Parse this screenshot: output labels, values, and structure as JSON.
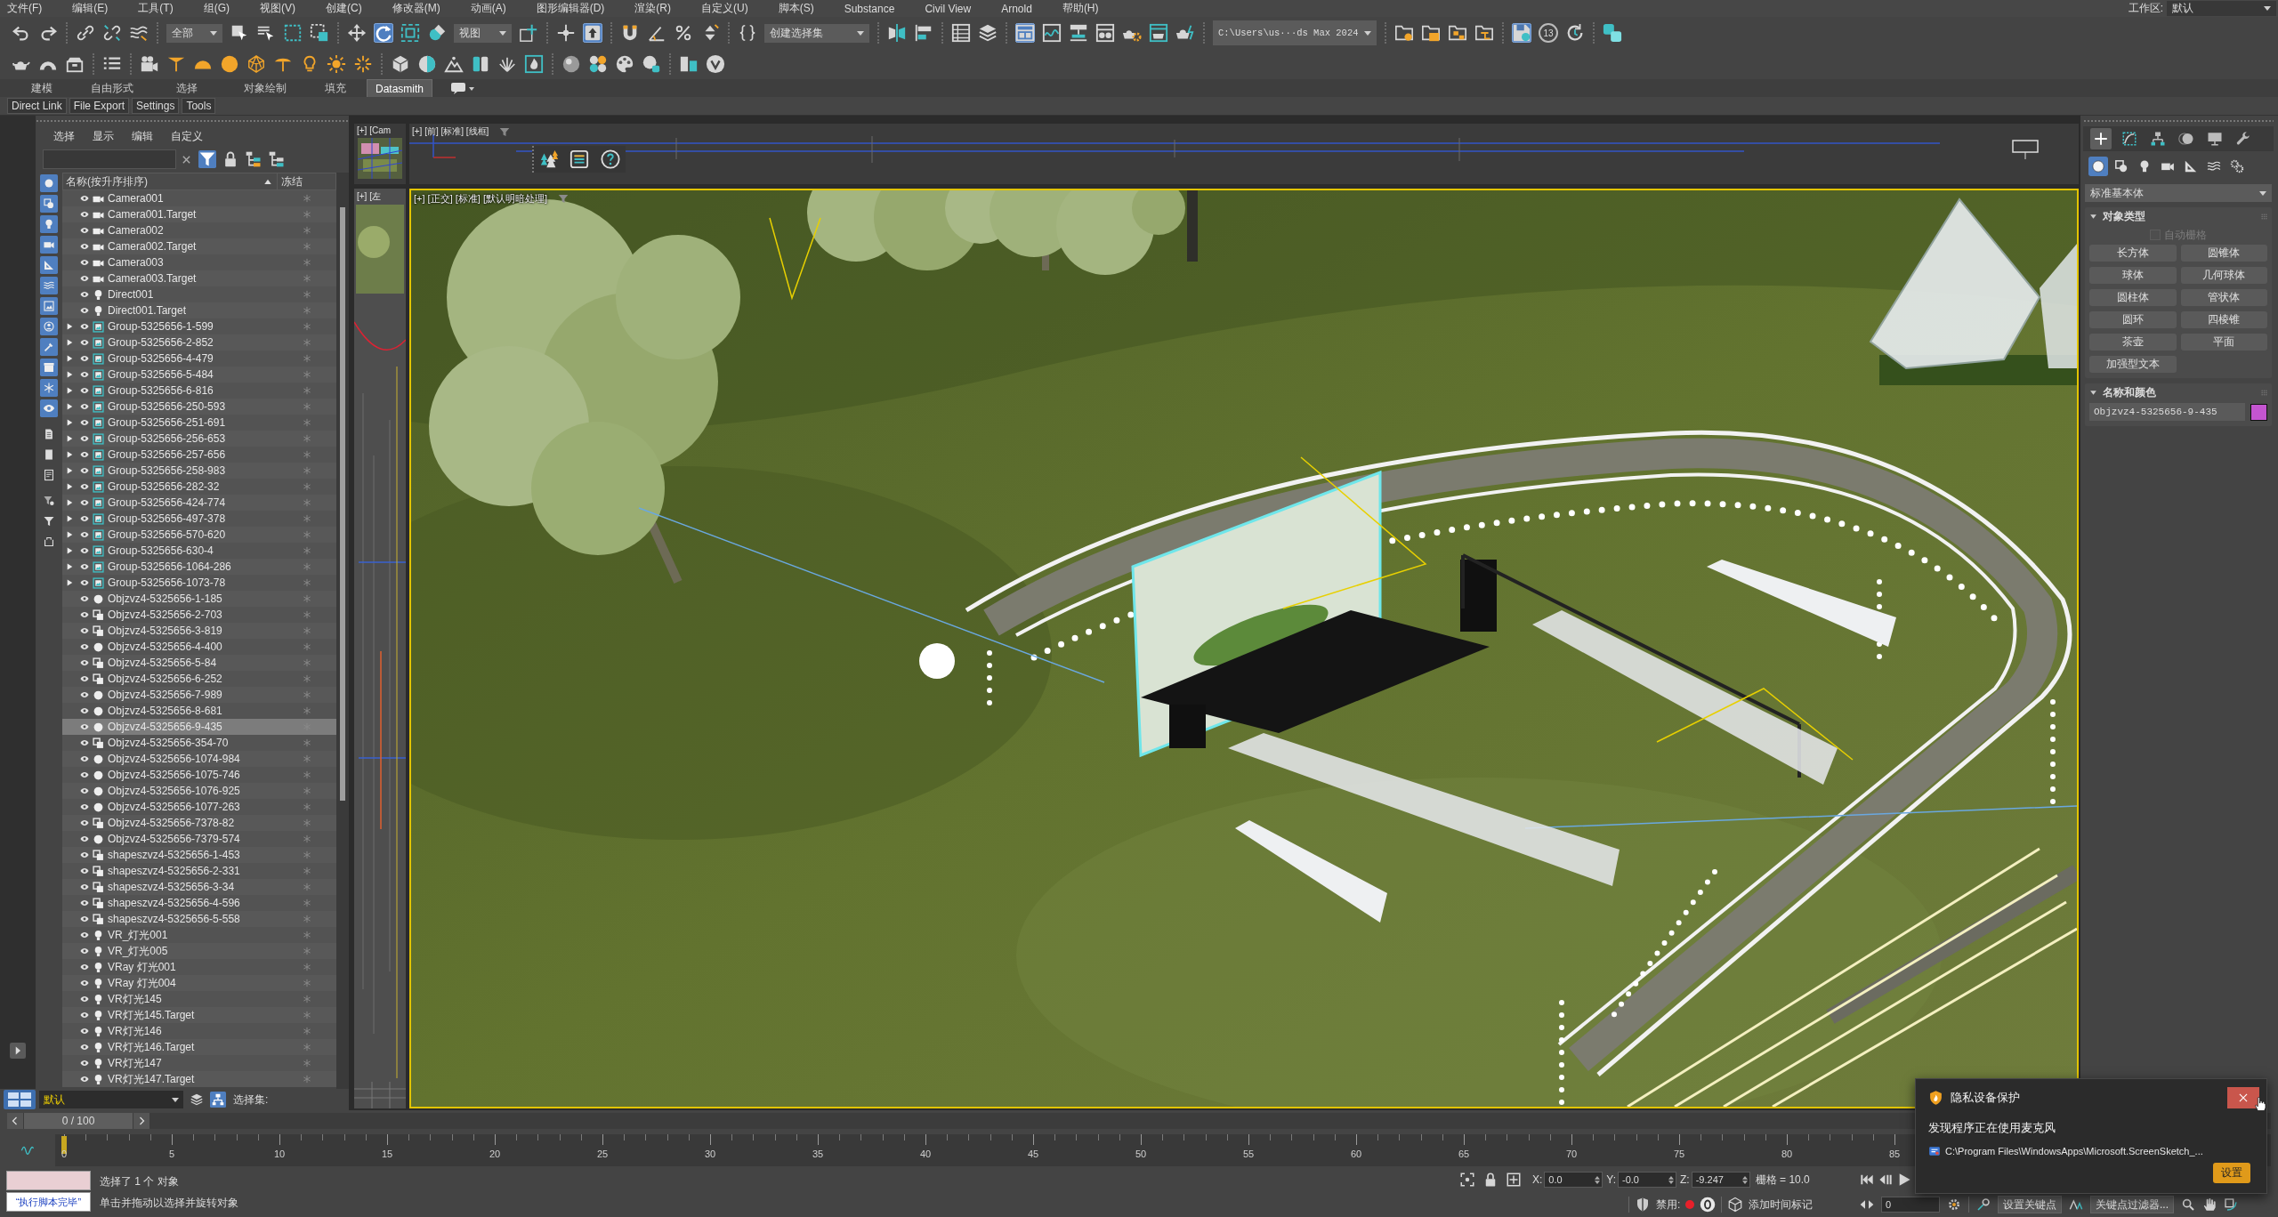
{
  "menu_bar": {
    "items": [
      "文件(F)",
      "编辑(E)",
      "工具(T)",
      "组(G)",
      "视图(V)",
      "创建(C)",
      "修改器(M)",
      "动画(A)",
      "图形编辑器(D)",
      "渲染(R)",
      "自定义(U)",
      "脚本(S)",
      "Substance",
      "Civil View",
      "Arnold",
      "帮助(H)"
    ],
    "workspace": {
      "label": "工作区:",
      "value": "默认"
    }
  },
  "main_toolbar": {
    "buttons": [
      {
        "selected": false
      },
      {
        "selected": false
      },
      {
        "selected": false
      },
      {
        "selected": false
      },
      {
        "selected": false
      },
      {
        "selected": false
      },
      {
        "selected": false
      },
      {
        "selected": false
      },
      {
        "selected": false
      },
      {
        "selected": false
      },
      {
        "selected": true
      },
      {
        "selected": false
      },
      {
        "selected": false
      },
      {
        "selected": false
      },
      {
        "selected": false
      },
      {
        "selected": true
      },
      {
        "selected": false
      },
      {
        "selected": false
      },
      {
        "selected": false
      },
      {
        "selected": false
      },
      {
        "selected": false
      },
      {
        "selected": false
      },
      {
        "selected": false
      },
      {
        "selected": false
      },
      {
        "selected": false
      },
      {
        "selected": true
      },
      {
        "selected": false
      },
      {
        "selected": false
      },
      {
        "selected": false
      },
      {
        "selected": false
      },
      {
        "selected": false
      },
      {
        "selected": false
      },
      {
        "selected": false
      },
      {
        "selected": false
      },
      {
        "selected": false
      },
      {
        "selected": false
      },
      {
        "selected": true
      },
      {
        "selected": false
      },
      {
        "selected": false
      }
    ],
    "dropdowns": [
      {
        "value": "全部"
      },
      {
        "value": "视图"
      },
      {
        "value": "创建选择集"
      },
      {
        "value": "C:\\Users\\us···ds Max 2024"
      }
    ],
    "backup_counter": "13"
  },
  "ribbon": {
    "tabs": [
      {
        "label": "建模",
        "selected": false
      },
      {
        "label": "自由形式",
        "selected": false
      },
      {
        "label": "选择",
        "selected": false
      },
      {
        "label": "对象绘制",
        "selected": false
      },
      {
        "label": "填充",
        "selected": false
      },
      {
        "label": "Datasmith",
        "selected": true
      }
    ]
  },
  "datasmith_bar": {
    "buttons": [
      "Direct Link",
      "File Export",
      "Settings",
      "Tools"
    ]
  },
  "scene_explorer": {
    "menu": [
      "选择",
      "显示",
      "编辑",
      "自定义"
    ],
    "tools": [
      {
        "selected": true
      },
      {
        "selected": false
      },
      {
        "selected": false
      },
      {
        "selected": false
      }
    ],
    "filters": [
      {
        "on": true
      },
      {
        "on": true
      },
      {
        "on": true
      },
      {
        "on": true
      },
      {
        "on": true
      },
      {
        "on": true
      },
      {
        "on": true
      },
      {
        "on": true
      },
      {
        "on": true
      },
      {
        "on": true
      },
      {
        "on": true
      },
      {
        "on": true
      },
      {
        "on": false
      },
      {
        "on": false
      },
      {
        "on": false
      },
      {
        "on": false
      },
      {
        "on": false
      },
      {
        "on": false
      }
    ],
    "columns": [
      "名称(按升序排序)",
      "冻结"
    ],
    "rows": [
      {
        "name": "Camera001",
        "kind": "camera",
        "visible": true,
        "frozen": false,
        "selected": false
      },
      {
        "name": "Camera001.Target",
        "kind": "camera",
        "visible": true,
        "frozen": false,
        "selected": false
      },
      {
        "name": "Camera002",
        "kind": "camera",
        "visible": true,
        "frozen": false,
        "selected": false
      },
      {
        "name": "Camera002.Target",
        "kind": "camera",
        "visible": true,
        "frozen": false,
        "selected": false
      },
      {
        "name": "Camera003",
        "kind": "camera",
        "visible": true,
        "frozen": false,
        "selected": false
      },
      {
        "name": "Camera003.Target",
        "kind": "camera",
        "visible": true,
        "frozen": false,
        "selected": false
      },
      {
        "name": "Direct001",
        "kind": "light",
        "visible": true,
        "frozen": false,
        "selected": false
      },
      {
        "name": "Direct001.Target",
        "kind": "light",
        "visible": true,
        "frozen": false,
        "selected": false
      },
      {
        "name": "Group-5325656-1-599",
        "kind": "group",
        "expanded": false,
        "visible": true,
        "frozen": false,
        "selected": false
      },
      {
        "name": "Group-5325656-2-852",
        "kind": "group",
        "expanded": false,
        "visible": true,
        "frozen": false,
        "selected": false
      },
      {
        "name": "Group-5325656-4-479",
        "kind": "group",
        "expanded": false,
        "visible": true,
        "frozen": false,
        "selected": false
      },
      {
        "name": "Group-5325656-5-484",
        "kind": "group",
        "expanded": false,
        "visible": true,
        "frozen": false,
        "selected": false
      },
      {
        "name": "Group-5325656-6-816",
        "kind": "group",
        "expanded": false,
        "visible": true,
        "frozen": false,
        "selected": false
      },
      {
        "name": "Group-5325656-250-593",
        "kind": "group",
        "expanded": false,
        "visible": true,
        "frozen": false,
        "selected": false
      },
      {
        "name": "Group-5325656-251-691",
        "kind": "group",
        "expanded": false,
        "visible": true,
        "frozen": false,
        "selected": false
      },
      {
        "name": "Group-5325656-256-653",
        "kind": "group",
        "expanded": false,
        "visible": true,
        "frozen": false,
        "selected": false
      },
      {
        "name": "Group-5325656-257-656",
        "kind": "group",
        "expanded": false,
        "visible": true,
        "frozen": false,
        "selected": false
      },
      {
        "name": "Group-5325656-258-983",
        "kind": "group",
        "expanded": false,
        "visible": true,
        "frozen": false,
        "selected": false
      },
      {
        "name": "Group-5325656-282-32",
        "kind": "group",
        "expanded": false,
        "visible": true,
        "frozen": false,
        "selected": false
      },
      {
        "name": "Group-5325656-424-774",
        "kind": "group",
        "expanded": false,
        "visible": true,
        "frozen": false,
        "selected": false
      },
      {
        "name": "Group-5325656-497-378",
        "kind": "group",
        "expanded": false,
        "visible": true,
        "frozen": false,
        "selected": false
      },
      {
        "name": "Group-5325656-570-620",
        "kind": "group",
        "expanded": false,
        "visible": true,
        "frozen": false,
        "selected": false
      },
      {
        "name": "Group-5325656-630-4",
        "kind": "group",
        "expanded": false,
        "visible": true,
        "frozen": false,
        "selected": false
      },
      {
        "name": "Group-5325656-1064-286",
        "kind": "group",
        "expanded": false,
        "visible": true,
        "frozen": false,
        "selected": false
      },
      {
        "name": "Group-5325656-1073-78",
        "kind": "group",
        "expanded": false,
        "visible": true,
        "frozen": false,
        "selected": false
      },
      {
        "name": "Objzvz4-5325656-1-185",
        "kind": "geometry",
        "visible": true,
        "frozen": false,
        "selected": false
      },
      {
        "name": "Objzvz4-5325656-2-703",
        "kind": "shape",
        "visible": true,
        "frozen": false,
        "selected": false
      },
      {
        "name": "Objzvz4-5325656-3-819",
        "kind": "shape",
        "visible": true,
        "frozen": false,
        "selected": false
      },
      {
        "name": "Objzvz4-5325656-4-400",
        "kind": "geometry",
        "visible": true,
        "frozen": false,
        "selected": false
      },
      {
        "name": "Objzvz4-5325656-5-84",
        "kind": "shape",
        "visible": true,
        "frozen": false,
        "selected": false
      },
      {
        "name": "Objzvz4-5325656-6-252",
        "kind": "shape",
        "visible": true,
        "frozen": false,
        "selected": false
      },
      {
        "name": "Objzvz4-5325656-7-989",
        "kind": "geometry",
        "visible": true,
        "frozen": false,
        "selected": false
      },
      {
        "name": "Objzvz4-5325656-8-681",
        "kind": "geometry",
        "visible": true,
        "frozen": false,
        "selected": false
      },
      {
        "name": "Objzvz4-5325656-9-435",
        "kind": "geometry",
        "visible": true,
        "frozen": false,
        "selected": true
      },
      {
        "name": "Objzvz4-5325656-354-70",
        "kind": "shape",
        "visible": true,
        "frozen": false,
        "selected": false
      },
      {
        "name": "Objzvz4-5325656-1074-984",
        "kind": "geometry",
        "visible": true,
        "frozen": false,
        "selected": false
      },
      {
        "name": "Objzvz4-5325656-1075-746",
        "kind": "geometry",
        "visible": true,
        "frozen": false,
        "selected": false
      },
      {
        "name": "Objzvz4-5325656-1076-925",
        "kind": "geometry",
        "visible": true,
        "frozen": false,
        "selected": false
      },
      {
        "name": "Objzvz4-5325656-1077-263",
        "kind": "geometry",
        "visible": true,
        "frozen": false,
        "selected": false
      },
      {
        "name": "Objzvz4-5325656-7378-82",
        "kind": "shape",
        "visible": true,
        "frozen": false,
        "selected": false
      },
      {
        "name": "Objzvz4-5325656-7379-574",
        "kind": "geometry",
        "visible": true,
        "frozen": false,
        "selected": false
      },
      {
        "name": "shapeszvz4-5325656-1-453",
        "kind": "shape",
        "visible": true,
        "frozen": false,
        "selected": false
      },
      {
        "name": "shapeszvz4-5325656-2-331",
        "kind": "shape",
        "visible": true,
        "frozen": false,
        "selected": false
      },
      {
        "name": "shapeszvz4-5325656-3-34",
        "kind": "shape",
        "visible": true,
        "frozen": false,
        "selected": false
      },
      {
        "name": "shapeszvz4-5325656-4-596",
        "kind": "shape",
        "visible": true,
        "frozen": false,
        "selected": false
      },
      {
        "name": "shapeszvz4-5325656-5-558",
        "kind": "shape",
        "visible": true,
        "frozen": false,
        "selected": false
      },
      {
        "name": "VR_灯光001",
        "kind": "light",
        "visible": true,
        "frozen": false,
        "selected": false
      },
      {
        "name": "VR_灯光005",
        "kind": "light",
        "visible": true,
        "frozen": false,
        "selected": false
      },
      {
        "name": "VRay 灯光001",
        "kind": "light",
        "visible": true,
        "frozen": false,
        "selected": false
      },
      {
        "name": "VRay 灯光004",
        "kind": "light",
        "visible": true,
        "frozen": false,
        "selected": false
      },
      {
        "name": "VR灯光145",
        "kind": "light",
        "visible": true,
        "frozen": false,
        "selected": false
      },
      {
        "name": "VR灯光145.Target",
        "kind": "light",
        "visible": true,
        "frozen": false,
        "selected": false
      },
      {
        "name": "VR灯光146",
        "kind": "light",
        "visible": true,
        "frozen": false,
        "selected": false
      },
      {
        "name": "VR灯光146.Target",
        "kind": "light",
        "visible": true,
        "frozen": false,
        "selected": false
      },
      {
        "name": "VR灯光147",
        "kind": "light",
        "visible": true,
        "frozen": false,
        "selected": false
      },
      {
        "name": "VR灯光147.Target",
        "kind": "light",
        "visible": true,
        "frozen": false,
        "selected": false
      }
    ]
  },
  "layer_bar": {
    "layer": "默认",
    "tools": [
      {
        "selected": false
      },
      {
        "selected": true
      }
    ],
    "selection_set_label": "选择集:"
  },
  "viewports": {
    "camera": {
      "label": "[+] [Cam"
    },
    "left": {
      "label": "[+] [左"
    },
    "front": {
      "label": "[+] [前] [标准] [线框]"
    },
    "main": {
      "label": "[+] [正交] [标准] [默认明暗处理]",
      "active": true
    }
  },
  "command_panel": {
    "tabs": [
      {
        "selected": true
      },
      {
        "selected": false
      },
      {
        "selected": false
      },
      {
        "selected": false
      },
      {
        "selected": false
      },
      {
        "selected": false
      }
    ],
    "categories": [
      {
        "selected": true
      },
      {
        "selected": false
      },
      {
        "selected": false
      },
      {
        "selected": false
      },
      {
        "selected": false
      },
      {
        "selected": false
      },
      {
        "selected": false
      }
    ],
    "type_dropdown": "标准基本体",
    "object_type": {
      "title": "对象类型",
      "autogrid": {
        "label": "自动栅格",
        "checked": false,
        "disabled": true
      },
      "buttons": [
        "长方体",
        "圆锥体",
        "球体",
        "几何球体",
        "圆柱体",
        "管状体",
        "圆环",
        "四棱锥",
        "茶壶",
        "平面",
        "加强型文本"
      ]
    },
    "name_and_color": {
      "title": "名称和颜色",
      "name": "Objzvz4-5325656-9-435",
      "color": "#c455d0"
    }
  },
  "time_slider": {
    "label": "0 / 100",
    "level": 0
  },
  "timeline": {
    "ticks": [
      "0",
      "5",
      "10",
      "15",
      "20",
      "25",
      "30",
      "35",
      "40",
      "45",
      "50",
      "55",
      "60",
      "65",
      "70",
      "75",
      "80",
      "85"
    ]
  },
  "status_bar": {
    "script_result": "“执行脚本完毕”",
    "selection_info": "选择了 1 个 对象",
    "prompt": "单击并拖动以选择并旋转对象",
    "coords": [
      {
        "axis": "X:",
        "value": "0.0"
      },
      {
        "axis": "Y:",
        "value": "-0.0"
      },
      {
        "axis": "Z:",
        "value": "-9.247"
      }
    ],
    "grid": "栅格 = 10.0",
    "disabled_label": "禁用:",
    "add_time_tag": "添加时间标记",
    "current_frame": "0",
    "set_key": "设置关键点",
    "key_filters": "关键点过滤器..."
  },
  "notification": {
    "title": "隐私设备保护",
    "message": "发现程序正在使用麦克风",
    "path": "C:\\Program Files\\WindowsApps\\Microsoft.ScreenSketch_...",
    "button": "设置"
  }
}
